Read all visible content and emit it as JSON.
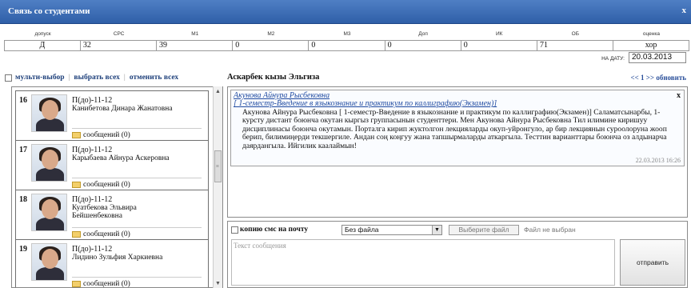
{
  "window": {
    "title": "Связь со студентами",
    "close_label": "x"
  },
  "grades": {
    "headers": [
      "допуск",
      "СРС",
      "М1",
      "М2",
      "М3",
      "Доп",
      "ИК",
      "ОБ",
      "оценка"
    ],
    "values": [
      "Д",
      "32",
      "39",
      "0",
      "0",
      "0",
      "0",
      "71",
      "хор"
    ]
  },
  "date": {
    "label": "НА ДАТУ:",
    "value": "20.03.2013"
  },
  "toolbar": {
    "multi_select": "мульти-выбор",
    "select_all": "выбрать всех",
    "deselect_all": "отменить всех",
    "separator": "|"
  },
  "selected_student": "Аскарбек кызы Эльгиза",
  "pager": {
    "prev": "<<",
    "page": "1",
    "next": ">>",
    "refresh": "обновить"
  },
  "students": [
    {
      "num": "16",
      "group": "П(до)-11-12",
      "name": "Канибетова Динара Жанатовна",
      "messages": "сообщений (0)"
    },
    {
      "num": "17",
      "group": "П(до)-11-12",
      "name": "Карыбаева Айнура Аскеровна",
      "messages": "сообщений (0)"
    },
    {
      "num": "18",
      "group": "П(до)-11-12",
      "name": "Куатбекова Эльвира Бейшенбековна",
      "messages": "сообщений (0)"
    },
    {
      "num": "19",
      "group": "П(до)-11-12",
      "name": "Лидино Зульфия Харкиевна",
      "messages": "сообщений (0)"
    }
  ],
  "message": {
    "author": "Акунова Айнура Рысбековна",
    "subject": "[ 1-семестр-Введение в языкознание и практикум по каллиграфию(Экзамен)]",
    "body": "Акунова Айнура Рысбековна [ 1-семестр-Введение в языкознание и практикум по каллиграфию(Экзамен)] Саламатсынарбы, 1-курсту дистант боюнча окутан кыргыз группасынын студенттери. Мен Акунова Айнура Рысбековна Тил илимине киришуу дисциплинасы боюнча окутамын. Порталга кирип жуктолгон лекцияларды окуп-уйронгуло, ар бир лекциянын суроолоруна жооп берип, билимиңерди текшергиле. Андан соң коңгуу жана тапшырмаларды аткаргыла. Тесттин варианттары боюнча оз алдынарча даярдангыла. Ийгилик каалаймын!",
    "timestamp": "22.03.2013 16:26",
    "close_label": "x"
  },
  "compose": {
    "copy_label": "копию смс на почту",
    "file_option": "Без файла",
    "choose_file": "Выберите файл",
    "no_file": "Файл не выбран",
    "placeholder": "Текст сообщения",
    "send_label": "отправить"
  }
}
